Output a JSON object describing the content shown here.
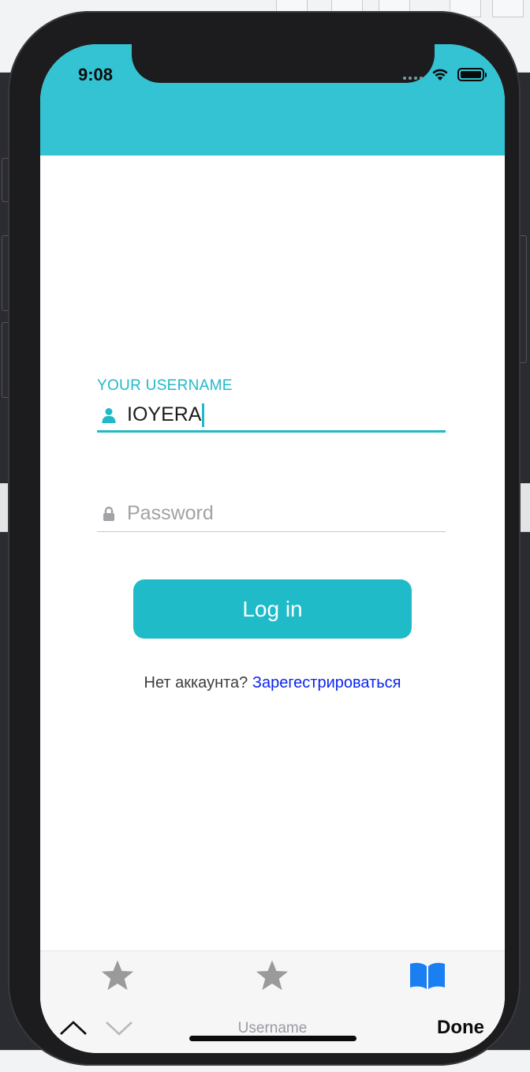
{
  "status_bar": {
    "time": "9:08"
  },
  "login": {
    "username_label": "YOUR USERNAME",
    "username_value": "IOYERA",
    "password_placeholder": "Password",
    "login_button": "Log in",
    "signup_prompt": "Нет аккаунта?",
    "signup_link": "Зарегестрироваться"
  },
  "tab_bar": {
    "items": [
      {
        "icon": "star-icon",
        "active": false
      },
      {
        "icon": "star-icon",
        "active": false
      },
      {
        "icon": "book-icon",
        "active": true
      }
    ]
  },
  "keyboard_accessory": {
    "field_name": "Username",
    "done_label": "Done"
  },
  "colors": {
    "accent": "#1fbbc9",
    "header": "#33c3d3",
    "link": "#0b25ee",
    "tab_active": "#1a7ff0",
    "tab_inactive": "#9a9a9a"
  }
}
